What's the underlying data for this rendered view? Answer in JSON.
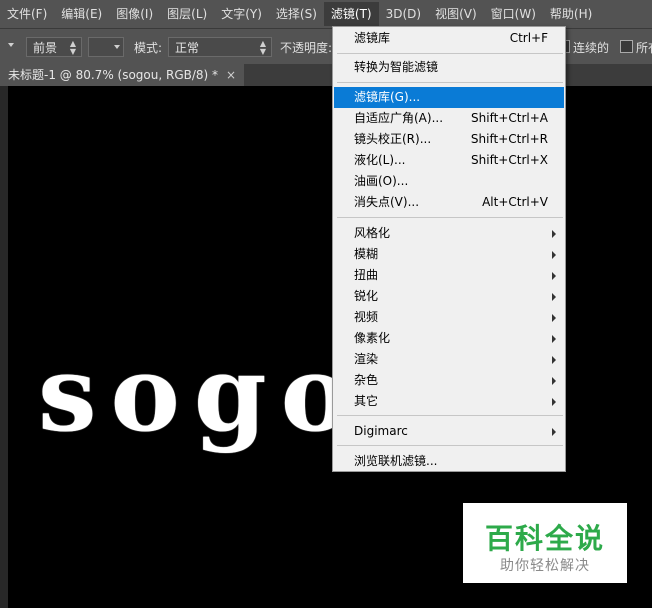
{
  "menubar": {
    "items": [
      "文件(F)",
      "编辑(E)",
      "图像(I)",
      "图层(L)",
      "文字(Y)",
      "选择(S)",
      "滤镜(T)",
      "3D(D)",
      "视图(V)",
      "窗口(W)",
      "帮助(H)"
    ]
  },
  "options": {
    "foreground_select": "前景",
    "mode_label": "模式:",
    "mode_value": "正常",
    "opacity_label": "不透明度:",
    "contiguous_label": "连续的",
    "all_layers_label": "所有"
  },
  "tab": {
    "title": "未标题-1 @ 80.7% (sogou, RGB/8) *",
    "close": "×"
  },
  "canvas": {
    "text": "sogou"
  },
  "filter_menu": {
    "items": [
      {
        "label": "滤镜库",
        "shortcut": "Ctrl+F"
      },
      {
        "label": "转换为智能滤镜",
        "shortcut": ""
      },
      {
        "label": "滤镜库(G)...",
        "shortcut": ""
      },
      {
        "label": "自适应广角(A)...",
        "shortcut": "Shift+Ctrl+A"
      },
      {
        "label": "镜头校正(R)...",
        "shortcut": "Shift+Ctrl+R"
      },
      {
        "label": "液化(L)...",
        "shortcut": "Shift+Ctrl+X"
      },
      {
        "label": "油画(O)...",
        "shortcut": ""
      },
      {
        "label": "消失点(V)...",
        "shortcut": "Alt+Ctrl+V"
      },
      {
        "label": "风格化",
        "shortcut": ""
      },
      {
        "label": "模糊",
        "shortcut": ""
      },
      {
        "label": "扭曲",
        "shortcut": ""
      },
      {
        "label": "锐化",
        "shortcut": ""
      },
      {
        "label": "视频",
        "shortcut": ""
      },
      {
        "label": "像素化",
        "shortcut": ""
      },
      {
        "label": "渲染",
        "shortcut": ""
      },
      {
        "label": "杂色",
        "shortcut": ""
      },
      {
        "label": "其它",
        "shortcut": ""
      },
      {
        "label": "Digimarc",
        "shortcut": ""
      },
      {
        "label": "浏览联机滤镜...",
        "shortcut": ""
      }
    ]
  },
  "watermark": {
    "title": "百科全说",
    "subtitle": "助你轻松解决"
  },
  "colors": {
    "highlight": "#0a7bd6",
    "menu_bg": "#f0f0f0",
    "app_bg": "#535353",
    "watermark_green": "#2daa4a"
  }
}
